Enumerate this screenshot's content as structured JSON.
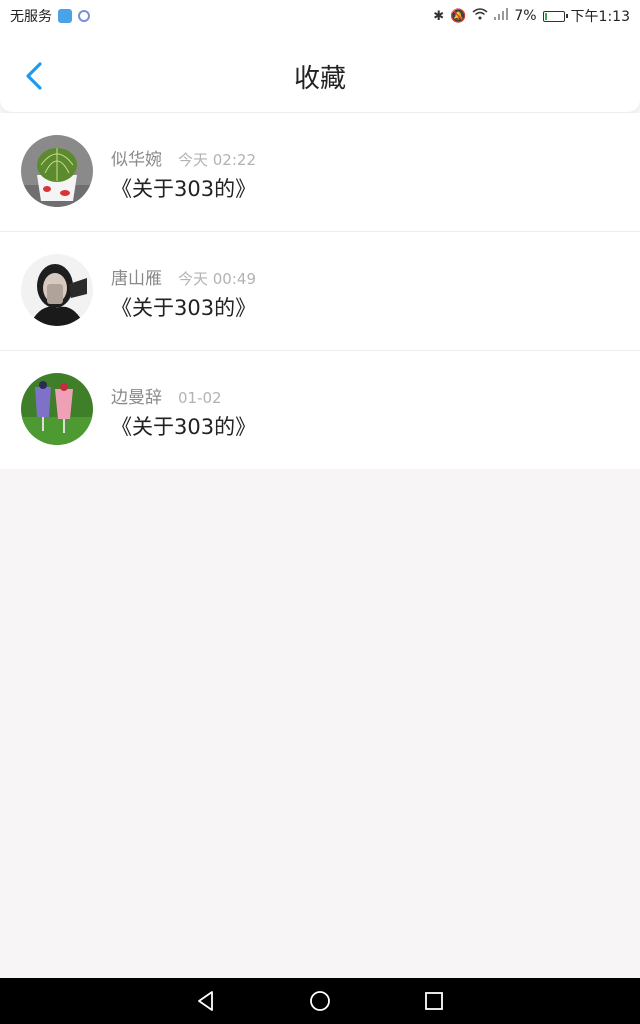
{
  "status_bar": {
    "carrier": "无服务",
    "battery_percent": "7%",
    "battery_level": 0.07,
    "time": "下午1:13",
    "icons": [
      "app-badge-icon",
      "music-icon",
      "bluetooth-icon",
      "mute-icon",
      "wifi-icon",
      "signal-icon",
      "battery-icon"
    ]
  },
  "header": {
    "title": "收藏"
  },
  "favorites": [
    {
      "name": "似华婉",
      "time": "今天 02:22",
      "content": "《关于303的》",
      "avatar": "cactus-avatar"
    },
    {
      "name": "唐山雁",
      "time": "今天 00:49",
      "content": "《关于303的》",
      "avatar": "girl-avatar"
    },
    {
      "name": "边曼辞",
      "time": "01-02",
      "content": "《关于303的》",
      "avatar": "drinks-avatar"
    }
  ],
  "colors": {
    "accent": "#1e9bf0",
    "background": "#f7f5f5"
  }
}
